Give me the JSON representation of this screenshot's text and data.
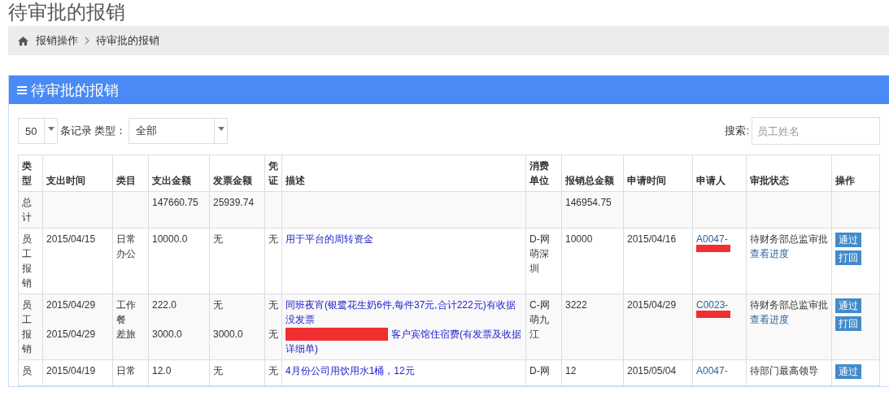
{
  "page_title": "待审批的报销",
  "breadcrumb": [
    {
      "label": "报销操作"
    },
    {
      "label": "待审批的报销"
    }
  ],
  "panel": {
    "title": "待审批的报销",
    "page_size": "50",
    "records_label": "条记录",
    "type_label": "类型：",
    "type_value": "全部",
    "search_label": "搜索:",
    "search_placeholder": "员工姓名",
    "table": {
      "columns": [
        "类型",
        "支出时间",
        "类目",
        "支出金额",
        "发票金额",
        "凭证",
        "描述",
        "消费单位",
        "报销总金额",
        "申请时间",
        "申请人",
        "审批状态",
        "操作"
      ],
      "total": {
        "type": "总计",
        "amount": "147660.75",
        "invoice": "25939.74",
        "total": "146954.75"
      },
      "rows": [
        {
          "type": "员工报销",
          "items": [
            {
              "time": "2015/04/15",
              "category": "日常办公",
              "amount": "10000.0",
              "invoice": "无",
              "voucher": "无",
              "description": "用于平台的周转资金",
              "redacted": false
            }
          ],
          "unit": "D-网萌深圳",
          "total": "10000",
          "apply_time": "2015/04/16",
          "applicant": "A0047-",
          "applicant_redacted": true,
          "status": "待财务部总监审批",
          "progress_link": "查看进度",
          "actions": [
            "通过",
            "打回"
          ]
        },
        {
          "type": "员工报销",
          "items": [
            {
              "time": "2015/04/29",
              "category": "工作餐",
              "amount": "222.0",
              "invoice": "无",
              "voucher": "无",
              "description": "同班夜宵(银鹭花生奶6件,每件37元,合计222元)有收据没发票",
              "redacted": false
            },
            {
              "time": "2015/04/29",
              "category": "差旅",
              "amount": "3000.0",
              "invoice": "3000.0",
              "voucher": "无",
              "description": "客户宾馆住宿费(有发票及收据详细单)",
              "redacted": true
            }
          ],
          "unit": "C-网萌九江",
          "total": "3222",
          "apply_time": "2015/04/29",
          "applicant": "C0023-",
          "applicant_redacted": true,
          "status": "待财务部总监审批",
          "progress_link": "查看进度",
          "actions": [
            "通过",
            "打回"
          ]
        },
        {
          "type": "员",
          "items": [
            {
              "time": "2015/04/19",
              "category": "日常",
              "amount": "12.0",
              "invoice": "无",
              "voucher": "无",
              "description": "4月份公司用饮用水1桶，12元",
              "redacted": false
            }
          ],
          "unit": "D-网",
          "total": "12",
          "apply_time": "2015/05/04",
          "applicant": "A0047-",
          "applicant_redacted": false,
          "status": "待部门最高领导",
          "actions": [
            "通过"
          ]
        }
      ]
    }
  }
}
